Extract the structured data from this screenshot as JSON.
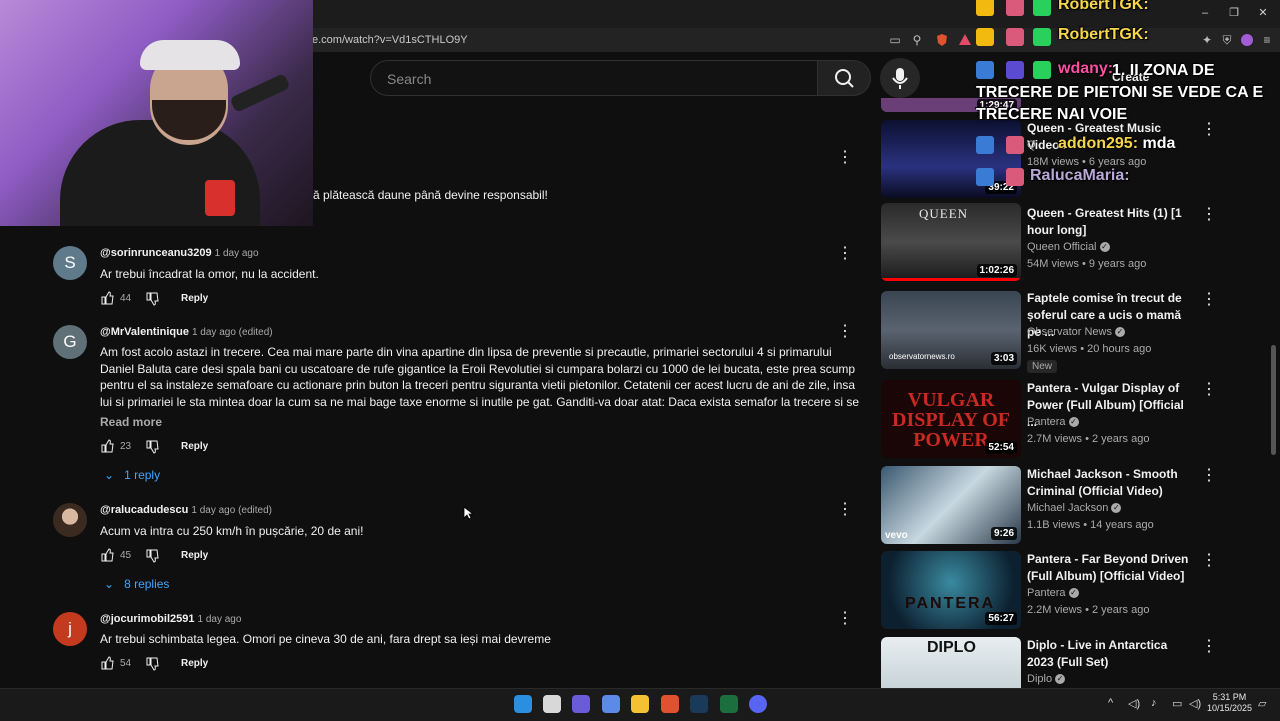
{
  "browser": {
    "url": "e.com/watch?v=Vd1sCTHLO9Y",
    "window_controls": [
      "–",
      "❐",
      "✕"
    ]
  },
  "youtube_header": {
    "search_placeholder": "Search",
    "create_label": "Create"
  },
  "comments": [
    {
      "partial_text": "ă plătească daune până devine responsabil!"
    },
    {
      "avatar_letter": "S",
      "avatar_color": "#5f7a8a",
      "author": "@sorinrunceanu3209",
      "time": "1 day ago",
      "text": "Ar trebui încadrat la omor, nu la accident.",
      "likes": "44",
      "reply_label": "Reply"
    },
    {
      "avatar_letter": "G",
      "avatar_color": "#5f7076",
      "author": "@MrValentinique",
      "time": "1 day ago (edited)",
      "text": "Am fost acolo astazi in trecere.  Cea mai mare parte din vina apartine din lipsa de preventie si precautie, primariei sectorului 4 si primarului Daniel Baluta care desi spala bani cu uscatoare de rufe gigantice la Eroii Revolutiei si cumpara bolarzi cu 1000 de lei bucata, este prea scump pentru el sa instaleze semafoare cu actionare prin buton la treceri pentru siguranta vietii pietonilor. Cetatenii cer acest lucru de ani de zile, insa lui si primariei le sta mintea doar la cum sa ne mai bage taxe enorme si inutile pe gat. Ganditi-va doar atat: Daca exista semafor la trecere si se punea rosu soferulu...",
      "read_more": "Read more",
      "likes": "23",
      "reply_label": "Reply",
      "replies_toggle": "1 reply"
    },
    {
      "avatar_color": "#6b4a3a",
      "author": "@ralucadudescu",
      "time": "1 day ago (edited)",
      "text": "Acum va intra cu 250 km/h în pușcărie, 20 de ani!",
      "likes": "45",
      "reply_label": "Reply",
      "replies_toggle": "8 replies"
    },
    {
      "avatar_letter": "j",
      "avatar_color": "#c43a1f",
      "author": "@jocurimobil2591",
      "time": "1 day ago",
      "text": "Ar trebui schimbata legea. Omori pe cineva 30 de ani, fara drept sa ieși mai devreme",
      "likes": "54",
      "reply_label": "Reply"
    }
  ],
  "sidebar": [
    {
      "duration": "1:29:47"
    },
    {
      "title": "Queen - Greatest Music Videos",
      "channel": "Q",
      "meta": "18M views • 6 years ago",
      "duration": "39:22"
    },
    {
      "title": "Queen - Greatest Hits (1) [1 hour long]",
      "channel": "Queen Official",
      "meta": "54M views • 9 years ago",
      "duration": "1:02:26",
      "thumb_text": "QUEEN"
    },
    {
      "title": "Faptele comise în trecut de șoferul care a ucis o mamă pe ...",
      "channel": "Observator News",
      "meta": "16K views • 20 hours ago",
      "badge": "New",
      "duration": "3:03",
      "thumb_text": "observatornews.ro"
    },
    {
      "title": "Pantera - Vulgar Display of Power (Full Album) [Official ...",
      "channel": "Pantera",
      "meta": "2.7M views • 2 years ago",
      "duration": "52:54",
      "thumb_text": "VULGAR DISPLAY OF POWER"
    },
    {
      "title": "Michael Jackson - Smooth Criminal (Official Video)",
      "channel": "Michael Jackson",
      "meta": "1.1B views • 14 years ago",
      "duration": "9:26",
      "thumb_text": "vevo"
    },
    {
      "title": "Pantera - Far Beyond Driven (Full Album) [Official Video]",
      "channel": "Pantera",
      "meta": "2.2M views • 2 years ago",
      "duration": "56:27",
      "thumb_text": "PANTERA"
    },
    {
      "title": "Diplo - Live in Antarctica 2023 (Full Set)",
      "channel": "Diplo",
      "thumb_text": "DIPLO"
    }
  ],
  "chat_overlay": [
    {
      "user": "RobertTGK:",
      "user_color": "#f6d64a"
    },
    {
      "user": "RobertTGK:",
      "user_color": "#f6d64a"
    },
    {
      "user": "wdany:",
      "user_color": "#ff4fa3",
      "message": "1. II ZONA DE TRECERE DE PIETONI SE VEDE CA E TRECERE NAI VOIE"
    },
    {
      "user": "addon295:",
      "user_color": "#f6d64a",
      "message": "mda"
    },
    {
      "user": "RalucaMaria:",
      "user_color": "#b9a7d8"
    }
  ],
  "taskbar": {
    "time": "5:31 PM",
    "date": "10/15/2025"
  }
}
